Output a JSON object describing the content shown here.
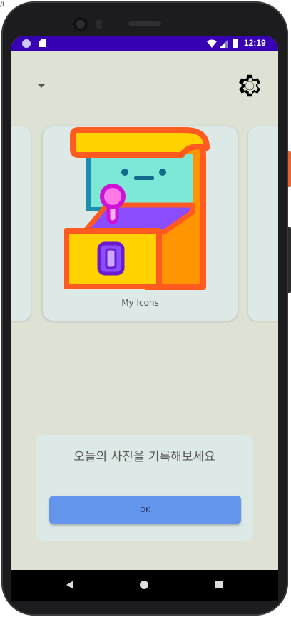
{
  "status_bar": {
    "time": "12:19"
  },
  "card": {
    "label": "My Icons"
  },
  "prompt": {
    "title": "오늘의 사진을 기록해보세요",
    "ok_label": "OK"
  },
  "top_left_fragment": "/I",
  "colors": {
    "status_bar": "#3700b3",
    "screen_bg": "#dde2d5",
    "card_bg": "#dde9e6",
    "ok_button": "#6495ed"
  }
}
